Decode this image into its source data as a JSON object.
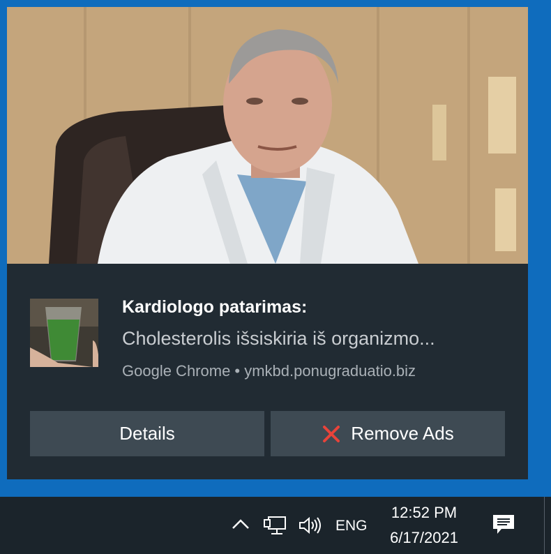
{
  "notification": {
    "title": "Kardiologo patarimas:",
    "message": "Cholesterolis išsiskiria iš organizmo...",
    "source": "Google Chrome • ymkbd.ponugraduatio.biz",
    "hero_image": "doctor-photo",
    "thumbnail_image": "green-juice-glass",
    "buttons": {
      "details_label": "Details",
      "remove_ads_label": "Remove Ads"
    }
  },
  "taskbar": {
    "tray_icons": [
      "chevron-up-icon",
      "network-icon",
      "volume-icon"
    ],
    "language": "ENG",
    "time": "12:52 PM",
    "date": "6/17/2021",
    "action_center_icon": "action-center-icon"
  },
  "colors": {
    "desktop_blue": "#0f6cbd",
    "toast_bg": "#212b33",
    "button_bg": "#3e4a53",
    "taskbar_bg": "#1b242b",
    "remove_icon_red": "#e8433a"
  }
}
